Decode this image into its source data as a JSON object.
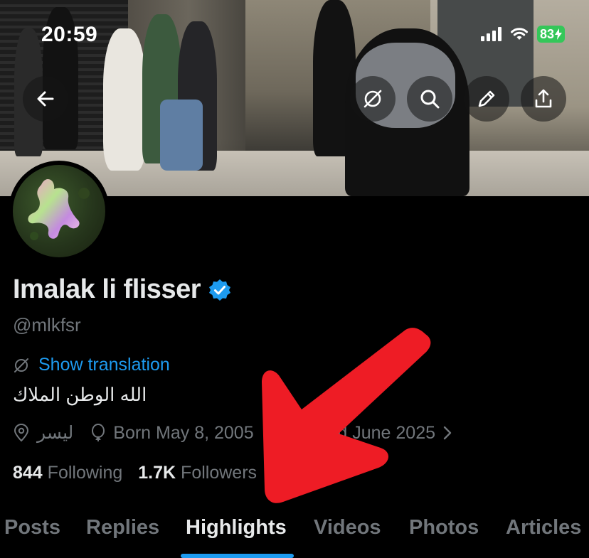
{
  "status_bar": {
    "time": "20:59",
    "battery": "83"
  },
  "header": {
    "back_icon": "arrow-left-icon",
    "buttons": [
      "translate-off-icon",
      "search-icon",
      "pencil-icon",
      "share-icon"
    ]
  },
  "profile": {
    "display_name": "Imalak li flisser",
    "verified": true,
    "handle": "@mlkfsr",
    "show_translation": "Show translation",
    "bio": "الله الوطن الملاك",
    "location": "ليسر",
    "birthday": "Born May 8, 2005",
    "joined": "Joined June 2025",
    "following_count": "844",
    "following_label": "Following",
    "followers_count": "1.7K",
    "followers_label": "Followers"
  },
  "tabs": [
    {
      "label": "Posts"
    },
    {
      "label": "Replies"
    },
    {
      "label": "Highlights",
      "active": true
    },
    {
      "label": "Videos"
    },
    {
      "label": "Photos"
    },
    {
      "label": "Articles"
    }
  ],
  "colors": {
    "accent": "#1d9bf0",
    "annotation_arrow": "#ee1c25",
    "battery": "#34c759"
  }
}
